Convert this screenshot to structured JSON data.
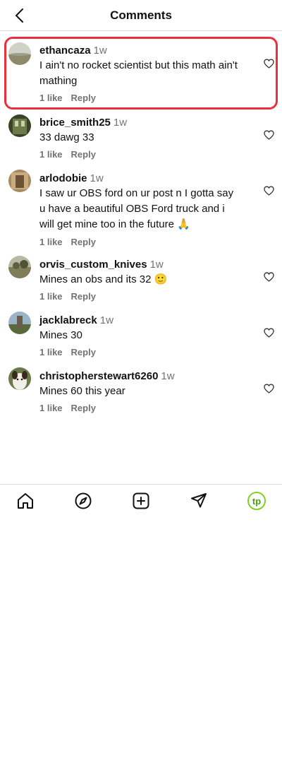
{
  "header": {
    "title": "Comments"
  },
  "comments": [
    {
      "username": "ethancaza",
      "time": "1w",
      "text": "I ain't no rocket scientist but this math ain't mathing",
      "likes": "1 like",
      "reply": "Reply"
    },
    {
      "username": "brice_smith25",
      "time": "1w",
      "text": "33 dawg 33",
      "likes": "1 like",
      "reply": "Reply"
    },
    {
      "username": "arlodobie",
      "time": "1w",
      "text": "I saw ur OBS ford on ur post n I gotta say u have a beautiful OBS Ford truck and i will get mine too in the future 🙏",
      "likes": "1 like",
      "reply": "Reply"
    },
    {
      "username": "orvis_custom_knives",
      "time": "1w",
      "text": "Mines an obs and its 32 🙂",
      "likes": "1 like",
      "reply": "Reply"
    },
    {
      "username": "jacklabreck",
      "time": "1w",
      "text": "Mines 30",
      "likes": "1 like",
      "reply": "Reply"
    },
    {
      "username": "christopherstewart6260",
      "time": "1w",
      "text": "Mines 60 this year",
      "likes": "1 like",
      "reply": "Reply"
    }
  ],
  "nav": {
    "logo_text": "tp"
  },
  "colors": {
    "highlight": "#e8313f",
    "logo": "#7ed321"
  }
}
